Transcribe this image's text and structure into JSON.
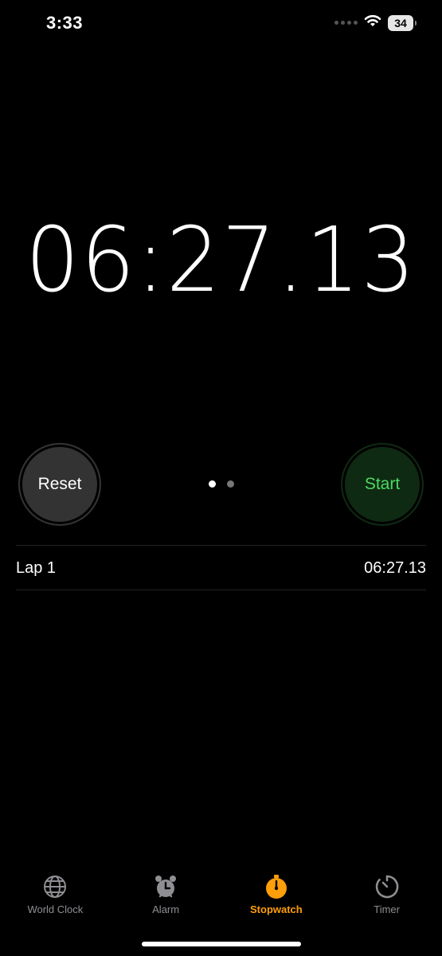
{
  "status_bar": {
    "time": "3:33",
    "battery": "34"
  },
  "stopwatch": {
    "elapsed": "06:27.13",
    "reset_label": "Reset",
    "start_label": "Start"
  },
  "laps": [
    {
      "label": "Lap 1",
      "time": "06:27.13"
    }
  ],
  "tabs": [
    {
      "label": "World Clock",
      "icon": "globe-icon",
      "active": false
    },
    {
      "label": "Alarm",
      "icon": "alarm-clock-icon",
      "active": false
    },
    {
      "label": "Stopwatch",
      "icon": "stopwatch-icon",
      "active": true
    },
    {
      "label": "Timer",
      "icon": "timer-icon",
      "active": false
    }
  ],
  "colors": {
    "accent": "#ff9f0a",
    "start_green": "#4cd964",
    "start_bg": "#0f2a12",
    "reset_bg": "#333333"
  }
}
